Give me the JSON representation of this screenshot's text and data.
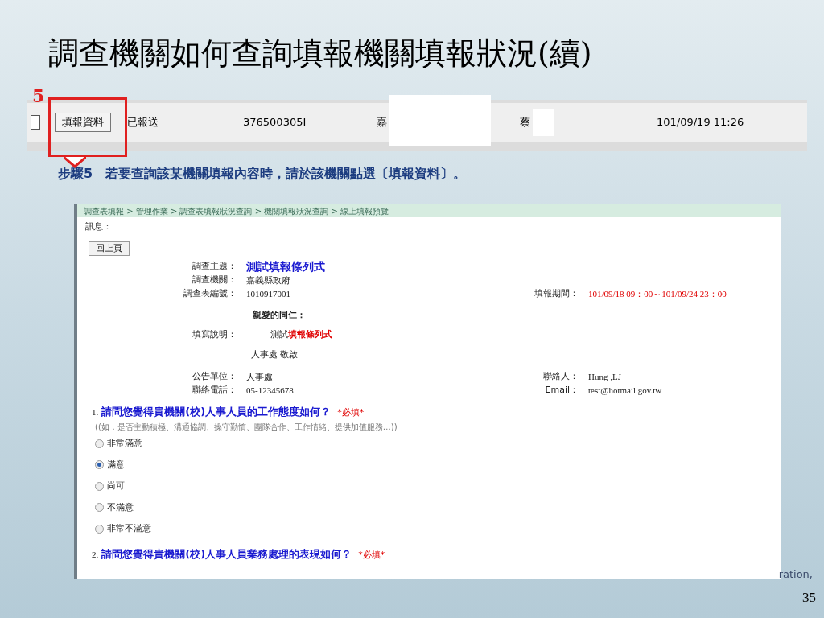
{
  "slide": {
    "title": "調查機關如何查詢填報機關填報狀況(續)",
    "page_number": "35",
    "logo_fragment": "ration,"
  },
  "callout": {
    "number": "5"
  },
  "table_row": {
    "checked": false,
    "button": "填報資料",
    "status": "已報送",
    "code": "376500305I",
    "column_4": "嘉",
    "column_5": "蔡",
    "time": "101/09/19 11:26"
  },
  "step": {
    "label": "步驟5",
    "text": "若要查詢該某機關填報內容時，請於該機關點選〔填報資料〕。"
  },
  "preview": {
    "breadcrumb": "調查表填報 > 管理作業 > 調查表填報狀況查詢 > 機關填報狀況查詢 > 線上填報預覽",
    "message_label": "訊息：",
    "back_button": "回上頁",
    "rows": [
      {
        "label": "調查主題：",
        "value": "測試填報條列式",
        "kind": "title"
      },
      {
        "label": "調查機關：",
        "value": "嘉義縣政府",
        "kind": "plain"
      },
      {
        "label": "調查表編號：",
        "value": "1010917001",
        "kind": "plain",
        "right": {
          "label": "填報期間：",
          "value": "101/09/18  09：00～101/09/24  23：00",
          "kind": "alert"
        }
      }
    ],
    "greeting": "親愛的同仁：",
    "instructions": {
      "label": "填寫說明：",
      "prefix": "測試",
      "emphasis": "填報條列式"
    },
    "signature": "人事處 敬啟",
    "contact_rows": [
      {
        "label": "公告單位：",
        "value": "人事處",
        "kind": "plain",
        "right": {
          "label": "聯絡人：",
          "value": "Hung ,LJ",
          "kind": "plain"
        }
      },
      {
        "label": "聯絡電話：",
        "value": "05-12345678",
        "kind": "plain",
        "right": {
          "label": "Email：",
          "value": "test@hotmail.gov.tw",
          "kind": "plain"
        }
      }
    ],
    "questions": [
      {
        "number": "1.",
        "text": "請問您覺得貴機關(校)人事人員的工作態度如何？",
        "required": "*必填*",
        "hint": "((如：是否主動積極、溝通協調、操守勤惰、團隊合作、工作情緒、提供加值服務…))",
        "options": [
          {
            "label": "非常滿意",
            "selected": false
          },
          {
            "label": "滿意",
            "selected": true
          },
          {
            "label": "尚可",
            "selected": false
          },
          {
            "label": "不滿意",
            "selected": false
          },
          {
            "label": "非常不滿意",
            "selected": false
          }
        ]
      },
      {
        "number": "2.",
        "text": "請問您覺得貴機關(校)人事人員業務處理的表現如何？",
        "required": "*必填*"
      }
    ]
  }
}
